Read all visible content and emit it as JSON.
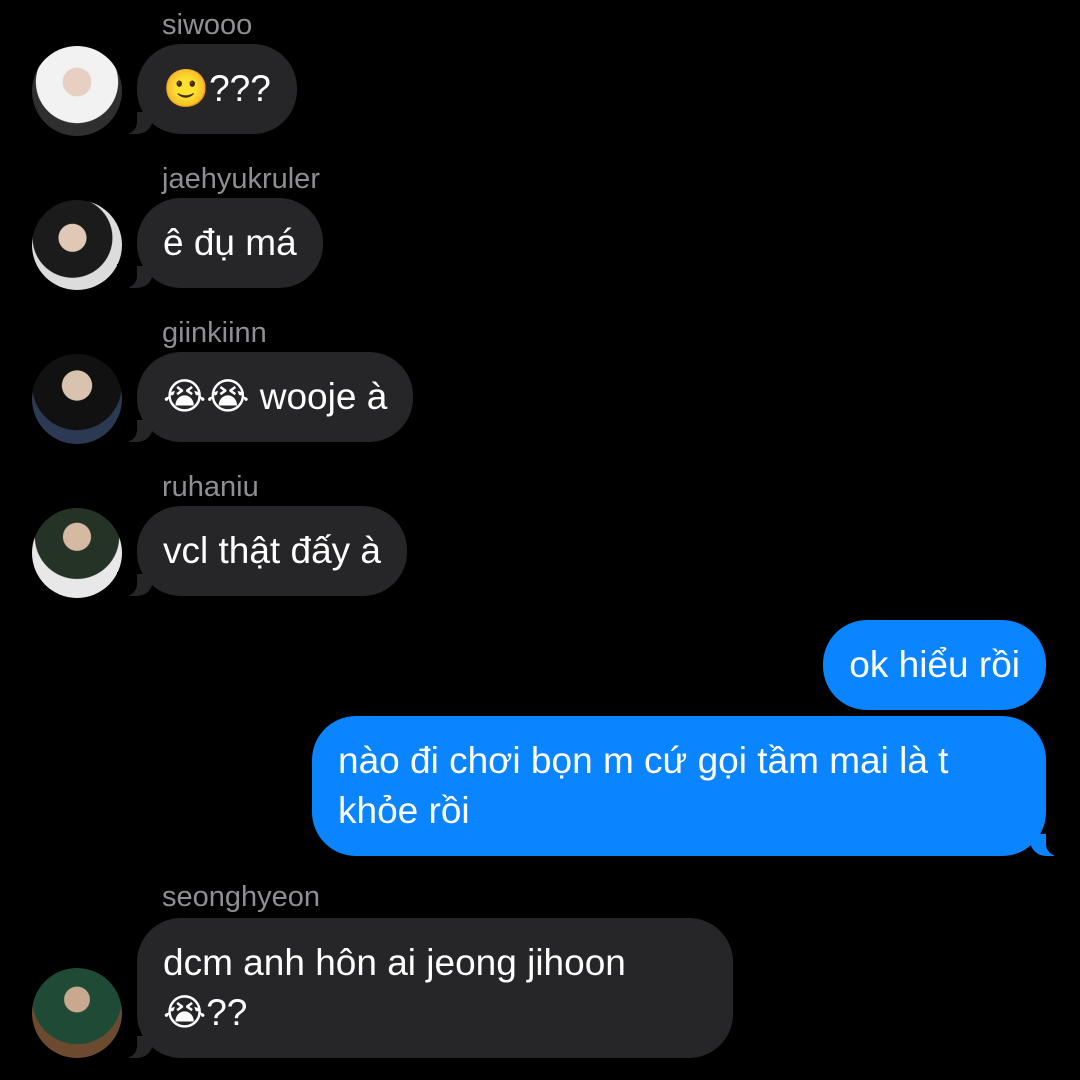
{
  "messages": [
    {
      "sender": "siwooo",
      "text": "🙂???"
    },
    {
      "sender": "jaehyukruler",
      "text": "ê đụ má"
    },
    {
      "sender": "giinkiinn",
      "text": "😭😭 wooje à"
    },
    {
      "sender": "ruhaniu",
      "text": "vcl thật đấy à"
    },
    {
      "sender": "",
      "text": "ok hiểu rồi"
    },
    {
      "sender": "",
      "text": "nào đi chơi bọn m cứ gọi tầm mai là t khỏe rồi"
    },
    {
      "sender": "seonghyeon",
      "text": "dcm anh hôn ai jeong jihoon 😭??"
    }
  ],
  "colors": {
    "background": "#000000",
    "incoming_bubble": "#262628",
    "outgoing_bubble": "#0A84FF",
    "sender_name": "#8E8E93"
  }
}
